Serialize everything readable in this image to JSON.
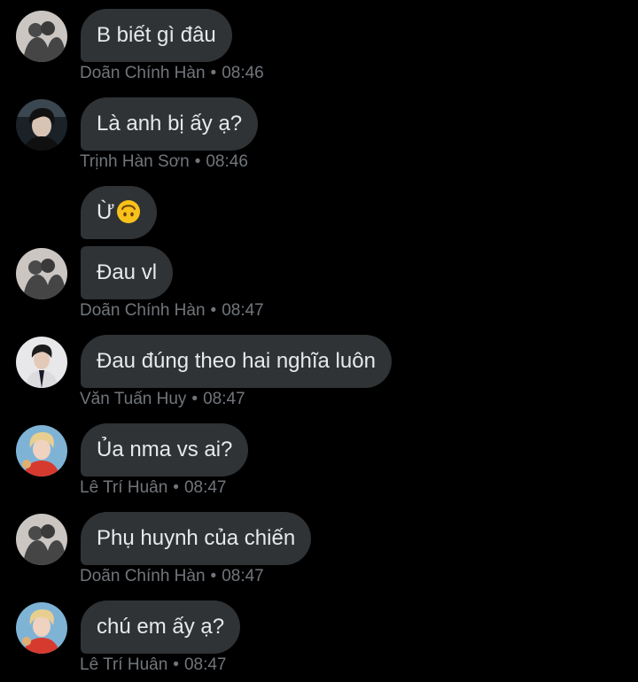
{
  "messages": [
    {
      "avatar": "avatar-silhouette-icon",
      "text": "B biết gì đâu",
      "sender": "Doãn Chính Hàn",
      "time": "08:46"
    },
    {
      "avatar": "avatar-dark-hair-icon",
      "text": "Là anh bị ấy ạ?",
      "sender": "Trịnh Hàn Sơn",
      "time": "08:46"
    },
    {
      "avatar": "avatar-silhouette-icon",
      "text": "Ừ",
      "emoji": "upside-down-face-icon"
    },
    {
      "avatar": "avatar-silhouette-icon",
      "text": "Đau vl",
      "sender": "Doãn Chính Hàn",
      "time": "08:47"
    },
    {
      "avatar": "avatar-suit-icon",
      "text": "Đau đúng theo hai nghĩa luôn",
      "sender": "Văn Tuấn Huy",
      "time": "08:47"
    },
    {
      "avatar": "avatar-blonde-icon",
      "text": "Ủa nma vs ai?",
      "sender": "Lê Trí Huân",
      "time": "08:47"
    },
    {
      "avatar": "avatar-silhouette-icon",
      "text": "Phụ huynh của chiến",
      "sender": "Doãn Chính Hàn",
      "time": "08:47"
    },
    {
      "avatar": "avatar-blonde-icon",
      "text": "chú em ấy ạ?",
      "sender": "Lê Trí Huân",
      "time": "08:47"
    }
  ],
  "separator": "•",
  "colors": {
    "background": "#000000",
    "bubble": "#2f3336",
    "text": "#e7e9ea",
    "meta": "#71767b"
  }
}
